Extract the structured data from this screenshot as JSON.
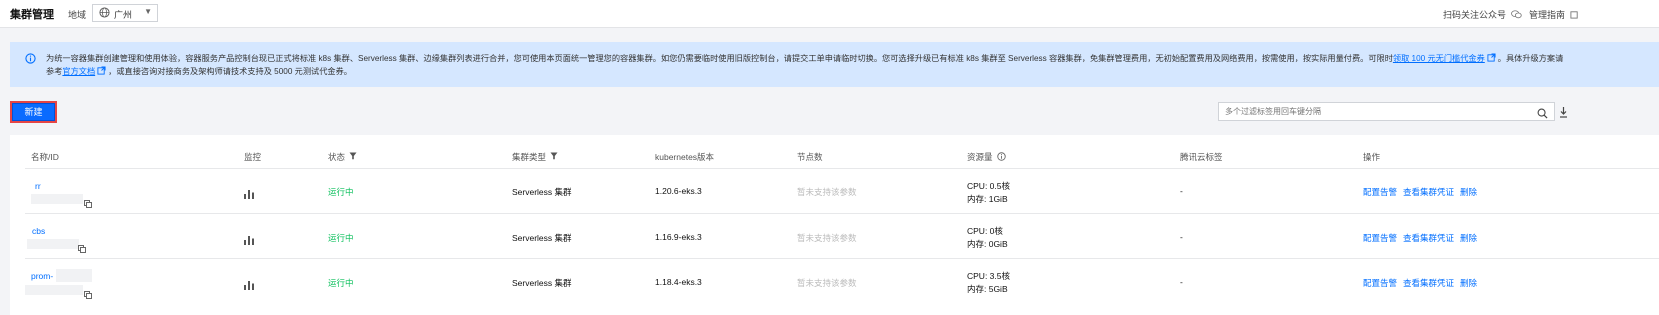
{
  "header": {
    "title": "集群管理",
    "region_label": "地域",
    "region_value": "广州",
    "follow_text": "扫码关注公众号",
    "guide_text": "管理指南"
  },
  "notice": {
    "text_main": "为统一容器集群创建管理和使用体验，容器服务产品控制台现已正式将标准 k8s 集群、Serverless 集群、边缘集群列表进行合并，您可使用本页面统一管理您的容器集群。如您仍需要临时使用旧版控制台，请提交工单申请临时切换。您可选择升级已有标准 k8s 集群至 Serverless 容器集群，免集群管理费用，无初始配置费用及网络费用，按需使用，按实际用量付费。可限时",
    "link_trial": "领取 100 元无门槛代金券",
    "text_after_trial": "。具体升级方案请",
    "text_ref": "参考",
    "link_doc": "官方文档",
    "text_end": "，或直接咨询对接商务及架构师请技术支持及 5000 元测试代金券。"
  },
  "toolbar": {
    "new_label": "新建",
    "search_placeholder": "多个过滤标签用回车键分隔"
  },
  "table": {
    "headers": {
      "name": "名称/ID",
      "monitor": "监控",
      "status": "状态",
      "type": "集群类型",
      "k8s": "kubernetes版本",
      "nodes": "节点数",
      "resources": "资源量",
      "tags": "腾讯云标签",
      "ops": "操作"
    },
    "rows": [
      {
        "name": "rr",
        "status": "运行中",
        "type": "Serverless 集群",
        "version": "1.20.6-eks.3",
        "nodes": "暂未支持该参数",
        "cpu": "CPU: 0.5核",
        "mem": "内存: 1GiB",
        "tags": "-",
        "op1": "配置告警",
        "op2": "查看集群凭证",
        "op3": "删除"
      },
      {
        "name": "cbs",
        "status": "运行中",
        "type": "Serverless 集群",
        "version": "1.16.9-eks.3",
        "nodes": "暂未支持该参数",
        "cpu": "CPU: 0核",
        "mem": "内存: 0GiB",
        "tags": "-",
        "op1": "配置告警",
        "op2": "查看集群凭证",
        "op3": "删除"
      },
      {
        "name": "prom-",
        "status": "运行中",
        "type": "Serverless 集群",
        "version": "1.18.4-eks.3",
        "nodes": "暂未支持该参数",
        "cpu": "CPU: 3.5核",
        "mem": "内存: 5GiB",
        "tags": "-",
        "op1": "配置告警",
        "op2": "查看集群凭证",
        "op3": "删除"
      }
    ]
  },
  "colors": {
    "primary": "#006eff",
    "running": "#0abf5b",
    "notice_bg": "#d5e7ff",
    "highlight_border": "#e54545"
  }
}
